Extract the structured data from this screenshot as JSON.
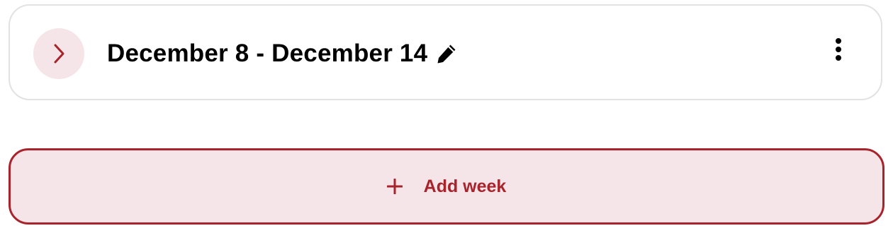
{
  "colors": {
    "accent": "#a8242c",
    "accent_light": "#f5e4e8",
    "card_border": "#e2e2e2",
    "text": "#000000"
  },
  "week": {
    "title": "December 8 - December 14",
    "expand_icon": "chevron-right-icon",
    "edit_icon": "pencil-icon",
    "menu_icon": "more-vertical-icon"
  },
  "add_week": {
    "label": "Add week",
    "icon": "plus-icon"
  }
}
